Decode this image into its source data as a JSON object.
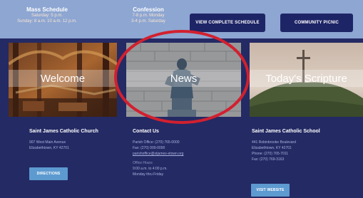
{
  "topbar": {
    "mass": {
      "title": "Mass Schedule",
      "line1": "Saturday: 5 p.m.",
      "line2": "Sunday: 8 a.m. 10 a.m. 12 p.m."
    },
    "confession": {
      "title": "Confession",
      "line1": "7-8 p.m. Monday",
      "line2": "3-4 p.m. Saturday"
    },
    "schedule_button": "VIEW COMPLETE SCHEDULE",
    "picnic_button": "COMMUNITY PICNIC"
  },
  "tiles": {
    "welcome": "Welcome",
    "news": "News",
    "scripture": "Today's Scripture"
  },
  "footer": {
    "church": {
      "title": "Saint James Catholic Church",
      "line1": "907 West Main Avenue",
      "line2": "Elizabethtown, KY 42701",
      "button": "DIRECTIONS"
    },
    "contact": {
      "title": "Contact Us",
      "office": "Parish Office: (270) 765-0000",
      "fax": "Fax: (270) 000-0000",
      "email": "parishoffice@stjames-etown.org",
      "hours_title": "Office Hours",
      "hours": "9:00 a.m. to 4:00 p.m.",
      "days": "Monday thru Friday"
    },
    "school": {
      "title": "Saint James Catholic School",
      "line1": "441 Robinbrooke Boulevard",
      "line2": "Elizabethtown, KY 42701",
      "phone": "Phone: (270) 765-7011",
      "fax": "Fax: (270) 769-3163",
      "button": "VISIT WEBSITE"
    }
  },
  "colors": {
    "topbar": "#8da6d2",
    "page_bg": "#242a64",
    "pill_bg": "#1e2566",
    "footer_button": "#5d9ad0",
    "annotation": "#d2202f"
  },
  "icons": {
    "annotation": "red-ellipse-annotation"
  }
}
